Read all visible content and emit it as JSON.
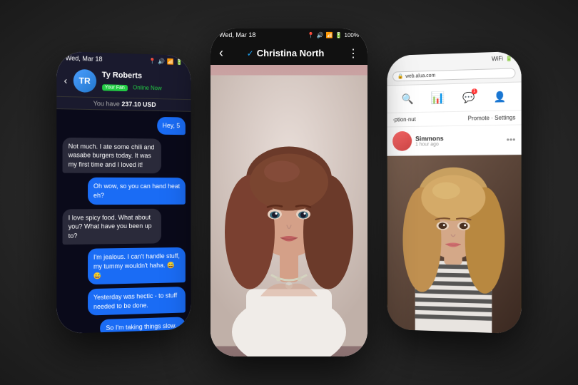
{
  "scene": {
    "bg_color": "#2a2a2a"
  },
  "left_phone": {
    "status_bar": {
      "date": "Wed, Mar 18",
      "icons": "📍 🔊 📶 🔋"
    },
    "header": {
      "back": "‹",
      "name": "Ty Roberts",
      "fan_label": "Your Fan",
      "online_label": "Online Now"
    },
    "balance": {
      "label": "You have",
      "amount": "237.10 USD"
    },
    "messages": [
      {
        "type": "sent",
        "text": "Hey, 5"
      },
      {
        "type": "received",
        "text": "Not much. I ate some chili and wasabe burgers today. It was my first time and I loved it!"
      },
      {
        "type": "sent",
        "text": "Oh wow, so you can hand heat eh?"
      },
      {
        "type": "received",
        "text": "I love spicy food. What about you? What have you been up to?"
      },
      {
        "type": "sent",
        "text": "I'm jealous. I can't handle stuff, my tummy wouldn't haha. 😅😅"
      },
      {
        "type": "sent",
        "text": "Yesterday was hectic - to stuff needed to be done."
      },
      {
        "type": "sent",
        "text": "So I'm taking things slow..."
      }
    ]
  },
  "center_phone": {
    "status_bar": {
      "date": "Wed, Mar 18",
      "icons": "📍 🔊 📶 🔋 100%"
    },
    "header": {
      "back": "‹",
      "name": "Christina North",
      "verified": "✓",
      "more": "⋮"
    }
  },
  "right_phone": {
    "status_bar": {
      "icons": "📶 🔋"
    },
    "browser": {
      "url": "web.alua.com",
      "lock": "🔒"
    },
    "nav_icons": {
      "search": "🔍",
      "stats": "📊",
      "messages": "💬",
      "profile": "👤"
    },
    "page_header": {
      "left": "·ption·nut",
      "right": "Promote · Settings"
    },
    "message_preview": {
      "name": "Simmons",
      "time": "1 hour ago",
      "dots": "•••"
    }
  }
}
